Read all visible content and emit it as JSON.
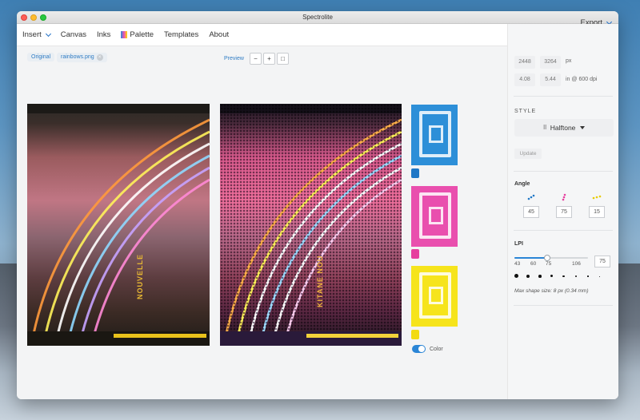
{
  "window": {
    "title": "Spectrolite"
  },
  "menu": {
    "insert": "Insert",
    "canvas": "Canvas",
    "inks": "Inks",
    "palette": "Palette",
    "templates": "Templates",
    "about": "About",
    "export": "Export"
  },
  "canvas": {
    "original_label": "Original",
    "filename": "rainbows.png",
    "preview_label": "Preview",
    "original_vertical_text": "NOUVELLE",
    "preview_vertical_text": "KITANE NOU",
    "color_toggle_label": "Color",
    "color_toggle_on": true
  },
  "inks": {
    "cyan": "#2d8fd8",
    "magenta": "#e94fae",
    "yellow": "#f6e41c"
  },
  "sidebar": {
    "width_px": "2448",
    "height_px": "3264",
    "px_unit": "px",
    "width_in": "4.08",
    "height_in": "5.44",
    "in_unit": "in @ 600 dpi",
    "style_heading": "STYLE",
    "style_value": "Halftone",
    "update_label": "Update",
    "angle_label": "Angle",
    "angles": [
      "45",
      "75",
      "15"
    ],
    "lpi_label": "LPI",
    "lpi_ticks": [
      "43",
      "60",
      "75",
      "106"
    ],
    "lpi_value": "75",
    "lpi_slider_fraction": 0.45,
    "max_shape_note": "Max shape size: 8 px (0.34 mm)"
  },
  "colors": {
    "accent": "#2a85d6"
  }
}
